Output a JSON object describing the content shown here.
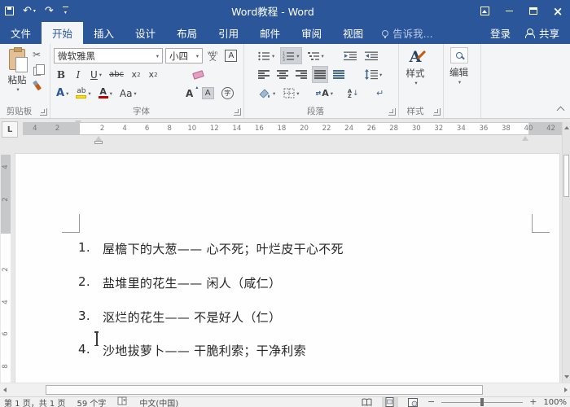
{
  "title_bar": {
    "title": "Word教程 - Word"
  },
  "tab_row": {
    "file": "文件",
    "tabs": [
      {
        "label": "开始",
        "active": true
      },
      {
        "label": "插入",
        "active": false
      },
      {
        "label": "设计",
        "active": false
      },
      {
        "label": "布局",
        "active": false
      },
      {
        "label": "引用",
        "active": false
      },
      {
        "label": "邮件",
        "active": false
      },
      {
        "label": "审阅",
        "active": false
      },
      {
        "label": "视图",
        "active": false
      }
    ],
    "tell_me": "告诉我...",
    "sign_in": "登录",
    "share": "共享"
  },
  "ribbon": {
    "clipboard": {
      "label": "剪贴板",
      "paste": "粘贴"
    },
    "font": {
      "label": "字体",
      "font_name": "微软雅黑",
      "font_size": "小四",
      "glyphs": {
        "bold": "B",
        "italic": "I",
        "underline": "U",
        "strikethrough": "abc",
        "subscript_base": "x",
        "subscript_small": "2",
        "superscript_base": "x",
        "superscript_small": "2",
        "text_effects": "A",
        "highlight": "ab",
        "font_color": "A",
        "change_case": "Aa",
        "grow_font": "A",
        "char_shading": "A",
        "enclose": "字",
        "phonetic_top": "wén",
        "phonetic_bottom": "文",
        "char_border": "A"
      }
    },
    "paragraph": {
      "label": "段落",
      "glyphs": {
        "sort_a": "A",
        "sort_z": "Z",
        "mark": "↵",
        "asian_a": "A",
        "asian_arrows": "⇄"
      }
    },
    "styles": {
      "label": "样式",
      "button": "样式",
      "glyph": "A"
    },
    "editing": {
      "button": "编辑"
    }
  },
  "ruler": {
    "tab_selector": "L",
    "left_margin_labels": [
      "4",
      "2"
    ],
    "main_labels": [
      "2",
      "4",
      "6",
      "8",
      "10",
      "12",
      "14",
      "16",
      "18",
      "20",
      "22",
      "24",
      "26",
      "28",
      "30",
      "32",
      "34",
      "36",
      "38"
    ],
    "right_margin_labels": [
      "40",
      "42"
    ],
    "v_margin_labels": [
      "4",
      "2"
    ],
    "v_main_labels": [
      "2",
      "4",
      "6",
      "8"
    ]
  },
  "document": {
    "lines": [
      {
        "num": "1.",
        "text": "屋檐下的大葱—— 心不死；叶烂皮干心不死"
      },
      {
        "num": "2.",
        "text": "盐堆里的花生—— 闲人（咸仁）"
      },
      {
        "num": "3.",
        "text": "沤烂的花生—— 不是好人（仁）"
      },
      {
        "num": "4.",
        "text": "沙地拔萝卜—— 干脆利索；干净利索"
      }
    ]
  },
  "status_bar": {
    "page_info": "第 1 页，共 1 页",
    "word_count": "59 个字",
    "language": "中文(中国)",
    "zoom_level": "100%"
  },
  "colors": {
    "accent_blue": "#2b579a",
    "highlight_yellow": "#ffe000",
    "font_color_red": "#c00000"
  }
}
